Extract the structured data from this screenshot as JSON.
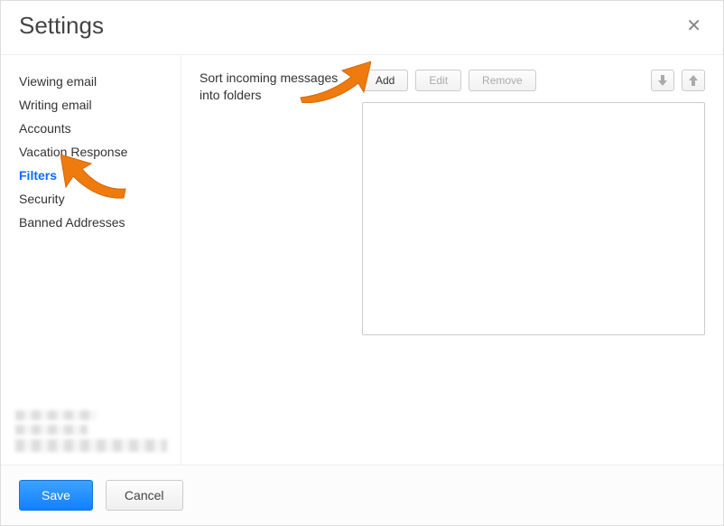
{
  "header": {
    "title": "Settings"
  },
  "sidebar": {
    "items": [
      {
        "label": "Viewing email"
      },
      {
        "label": "Writing email"
      },
      {
        "label": "Accounts"
      },
      {
        "label": "Vacation Response"
      },
      {
        "label": "Filters"
      },
      {
        "label": "Security"
      },
      {
        "label": "Banned Addresses"
      }
    ],
    "activeIndex": 4
  },
  "main": {
    "section_label": "Sort incoming messages into folders",
    "buttons": {
      "add": "Add",
      "edit": "Edit",
      "remove": "Remove"
    }
  },
  "footer": {
    "save": "Save",
    "cancel": "Cancel"
  }
}
